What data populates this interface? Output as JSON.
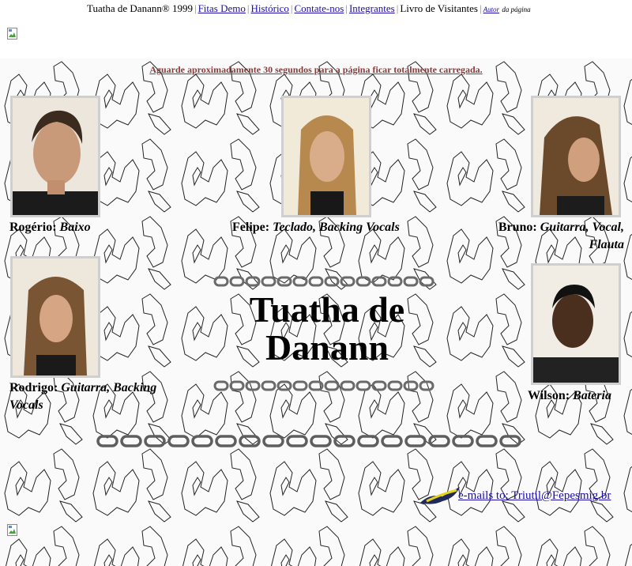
{
  "nav": {
    "site": "Tuatha de Danann® 1999",
    "links": [
      "Fitas Demo",
      "Histórico",
      "Contate-nos",
      "Integrantes"
    ],
    "current": "Livro de Visitantes",
    "author_link": "Autor",
    "author_suffix": "da página"
  },
  "notice": "Aguarde aproximadamente 30 segundos para a página ficar totalmente carregada.",
  "members": [
    {
      "name": "Rogério:",
      "role": "Baixo"
    },
    {
      "name": "Felipe:",
      "role": "Teclado, Backing Vocals"
    },
    {
      "name": "Bruno:",
      "role": "Guitarra, Vocal, Flauta"
    },
    {
      "name": "Rodrigo:",
      "role": "Guitarra, Backing Vocals"
    },
    {
      "name": "Wilson:",
      "role": "Bateria"
    }
  ],
  "band": {
    "line1": "Tuatha de",
    "line2": "Danann"
  },
  "email": {
    "label": "e-mails to: Triutil@Fepesmig.br"
  },
  "colors": {
    "link": "#1a0dab",
    "notice": "#8b3a3a",
    "frame": "#cfcfcf"
  }
}
